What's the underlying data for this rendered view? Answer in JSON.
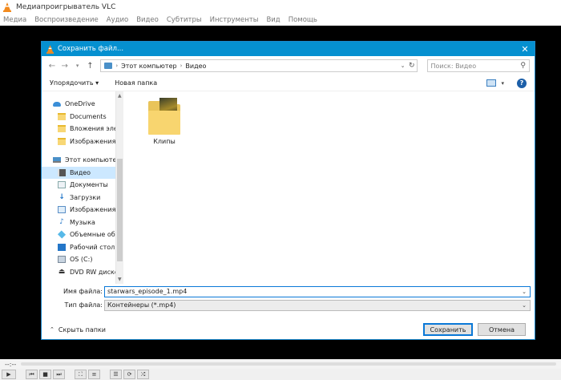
{
  "vlc": {
    "title": "Медиапроигрыватель VLC",
    "menu": [
      "Медиа",
      "Воспроизведение",
      "Аудио",
      "Видео",
      "Субтитры",
      "Инструменты",
      "Вид",
      "Помощь"
    ],
    "time": "--:--"
  },
  "dialog": {
    "title": "Сохранить файл...",
    "close": "✕",
    "address": {
      "segments": [
        "Этот компьютер",
        "Видео"
      ]
    },
    "search_placeholder": "Поиск: Видео",
    "toolbar": {
      "organize": "Упорядочить ▾",
      "new_folder": "Новая папка"
    },
    "nav_items": [
      {
        "label": "OneDrive",
        "icon": "cloud-icon"
      },
      {
        "label": "Documents",
        "icon": "folder-icon"
      },
      {
        "label": "Вложения элек",
        "icon": "folder-icon"
      },
      {
        "label": "Изображения",
        "icon": "folder-icon"
      },
      {
        "label": "Этот компьютер",
        "icon": "computer-icon"
      },
      {
        "label": "Видео",
        "icon": "video-icon",
        "selected": true
      },
      {
        "label": "Документы",
        "icon": "documents-icon"
      },
      {
        "label": "Загрузки",
        "icon": "downloads-icon"
      },
      {
        "label": "Изображения",
        "icon": "pictures-icon"
      },
      {
        "label": "Музыка",
        "icon": "music-icon"
      },
      {
        "label": "Объемные объ",
        "icon": "3d-objects-icon"
      },
      {
        "label": "Рабочий стол",
        "icon": "desktop-icon"
      },
      {
        "label": "OS (C:)",
        "icon": "drive-icon"
      },
      {
        "label": "DVD RW дисков",
        "icon": "dvd-icon"
      }
    ],
    "files": [
      {
        "label": "Клипы",
        "icon": "folder-icon"
      }
    ],
    "filename_label": "Имя файла:",
    "filename_value": "starwars_episode_1.mp4",
    "filetype_label": "Тип файла:",
    "filetype_value": "Контейнеры (*.mp4)",
    "hide_folders": "Скрыть папки",
    "save_button": "Сохранить",
    "cancel_button": "Отмена"
  },
  "colors": {
    "dialog_title_bg": "#0590d0",
    "selection_bg": "#cce8ff",
    "video_bg": "#000000"
  }
}
